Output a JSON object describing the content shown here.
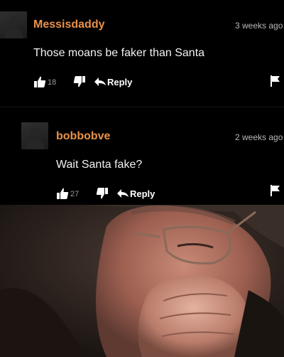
{
  "comments": [
    {
      "username": "Messisdaddy",
      "time": "3 weeks ago",
      "text": "Those moans be faker than Santa",
      "upvotes": "18",
      "reply_label": "Reply"
    },
    {
      "username": "bobbobve",
      "time": "2 weeks ago",
      "text": "Wait Santa fake?",
      "upvotes": "27",
      "reply_label": "Reply"
    }
  ],
  "icons": [
    "avatar-placeholder-icon",
    "thumbs-up-icon",
    "thumbs-down-icon",
    "reply-arrow-icon",
    "flag-icon"
  ],
  "colors": {
    "background": "#000000",
    "username": "#e8924a",
    "timestamp": "#b9b9b9",
    "comment_text": "#f2f2f2",
    "icon": "#ffffff"
  }
}
